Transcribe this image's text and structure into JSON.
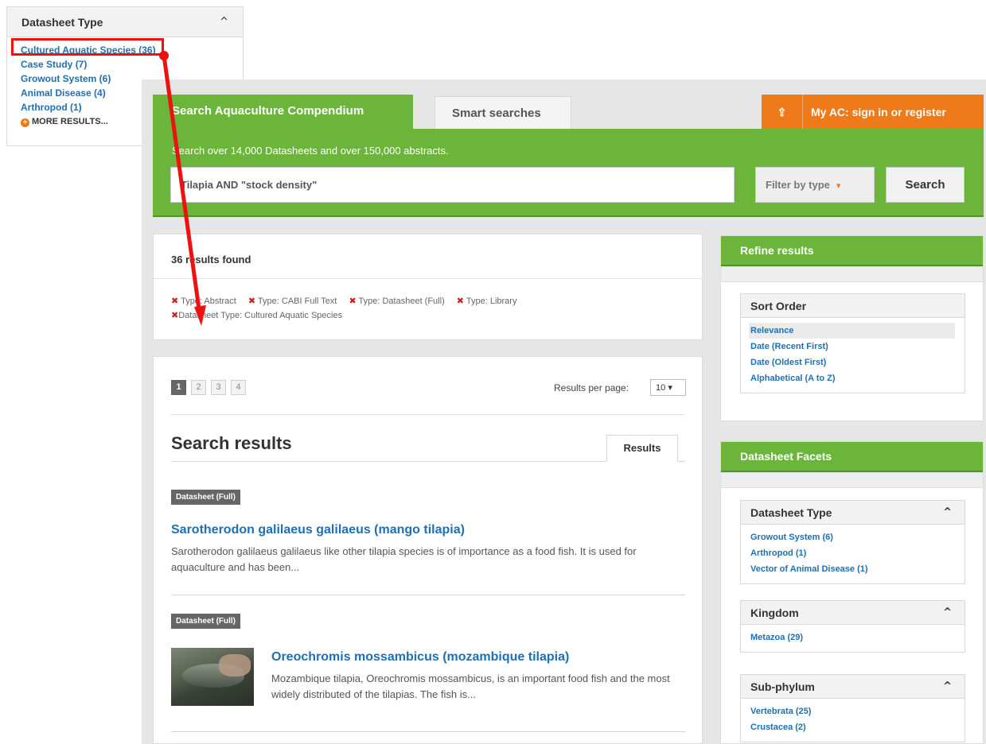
{
  "callout": {
    "header": "Datasheet Type",
    "items": [
      "Cultured Aquatic Species (36)",
      "Case Study (7)",
      "Growout System (6)",
      "Animal Disease (4)",
      "Arthropod (1)"
    ],
    "more": "MORE RESULTS..."
  },
  "tabs": {
    "search": "Search Aquaculture Compendium",
    "smart": "Smart searches",
    "account": "My AC: sign in or register"
  },
  "search": {
    "subtitle": "Search over 14,000 Datasheets and over 150,000 abstracts.",
    "query": "Tilapia AND \"stock density\"",
    "filter_label": "Filter by type",
    "button": "Search"
  },
  "results_summary": {
    "count_text": "36 results found",
    "filters": [
      "Type: Abstract",
      "Type: CABI Full Text",
      "Type: Datasheet (Full)",
      "Type: Library",
      "Datasheet Type: Cultured Aquatic Species"
    ]
  },
  "pagination": {
    "pages": [
      "1",
      "2",
      "3",
      "4"
    ],
    "per_page_label": "Results per page:",
    "per_page_value": "10"
  },
  "results": {
    "heading": "Search results",
    "tab": "Results",
    "items": [
      {
        "badge": "Datasheet (Full)",
        "title": "Sarotherodon galilaeus galilaeus (mango tilapia)",
        "desc": "Sarotherodon galilaeus galilaeus like other tilapia species is of importance as a food fish. It is used for aquaculture and has been..."
      },
      {
        "badge": "Datasheet (Full)",
        "title": "Oreochromis mossambicus (mozambique tilapia)",
        "desc": "Mozambique tilapia, Oreochromis mossambicus, is an important food fish and the most widely distributed of the tilapias. The fish is..."
      }
    ]
  },
  "refine": {
    "header": "Refine results",
    "sort_header": "Sort Order",
    "sort_options": [
      "Relevance",
      "Date (Recent First)",
      "Date (Oldest First)",
      "Alphabetical (A to Z)"
    ]
  },
  "facets": {
    "header": "Datasheet Facets",
    "groups": [
      {
        "title": "Datasheet Type",
        "items": [
          "Growout System (6)",
          "Arthropod (1)",
          "Vector of Animal Disease (1)"
        ]
      },
      {
        "title": "Kingdom",
        "items": [
          "Metazoa (29)"
        ]
      },
      {
        "title": "Sub-phylum",
        "items": [
          "Vertebrata (25)",
          "Crustacea (2)"
        ]
      }
    ]
  },
  "colors": {
    "green": "#6bb53a",
    "orange": "#ee7a1a",
    "link": "#1f6fb2",
    "annotation": "#ee1111"
  }
}
